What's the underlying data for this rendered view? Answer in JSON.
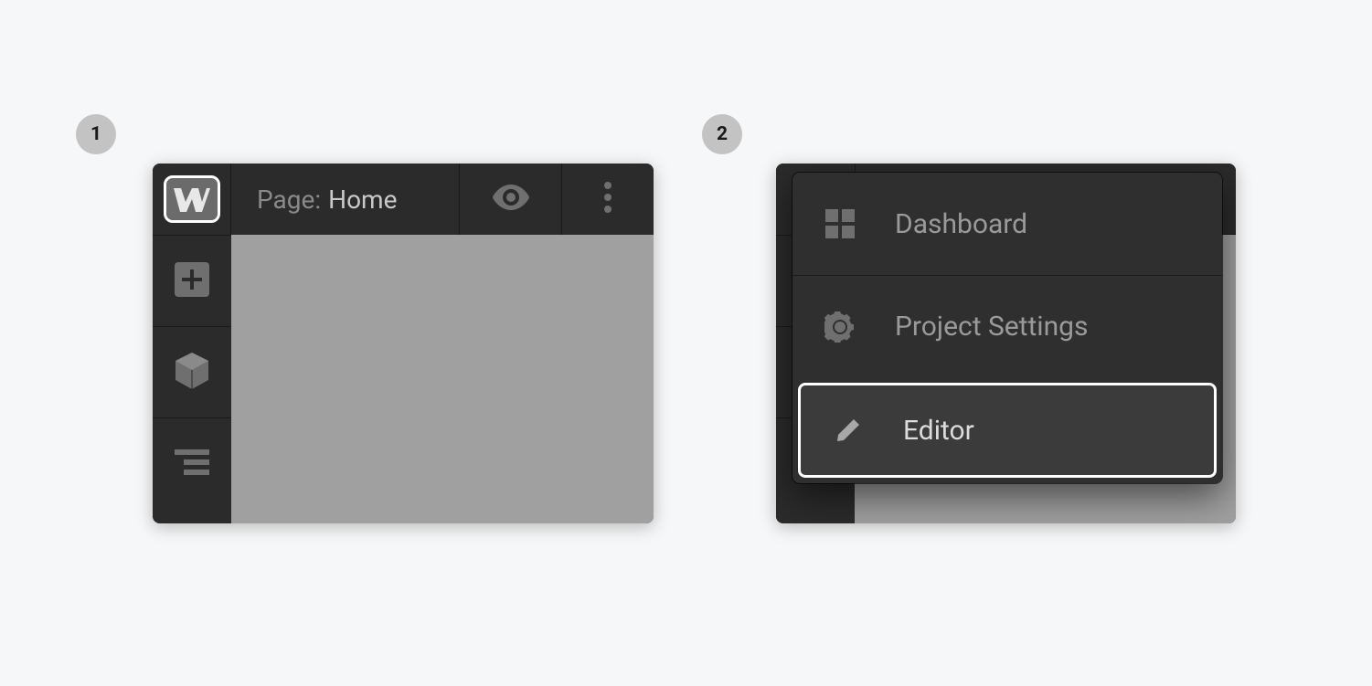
{
  "steps": {
    "one": "1",
    "two": "2"
  },
  "panel1": {
    "topbar": {
      "page_prefix": "Page:",
      "page_name": "Home"
    }
  },
  "panel2": {
    "menu": {
      "items": [
        {
          "label": "Dashboard"
        },
        {
          "label": "Project Settings"
        },
        {
          "label": "Editor"
        }
      ]
    }
  }
}
